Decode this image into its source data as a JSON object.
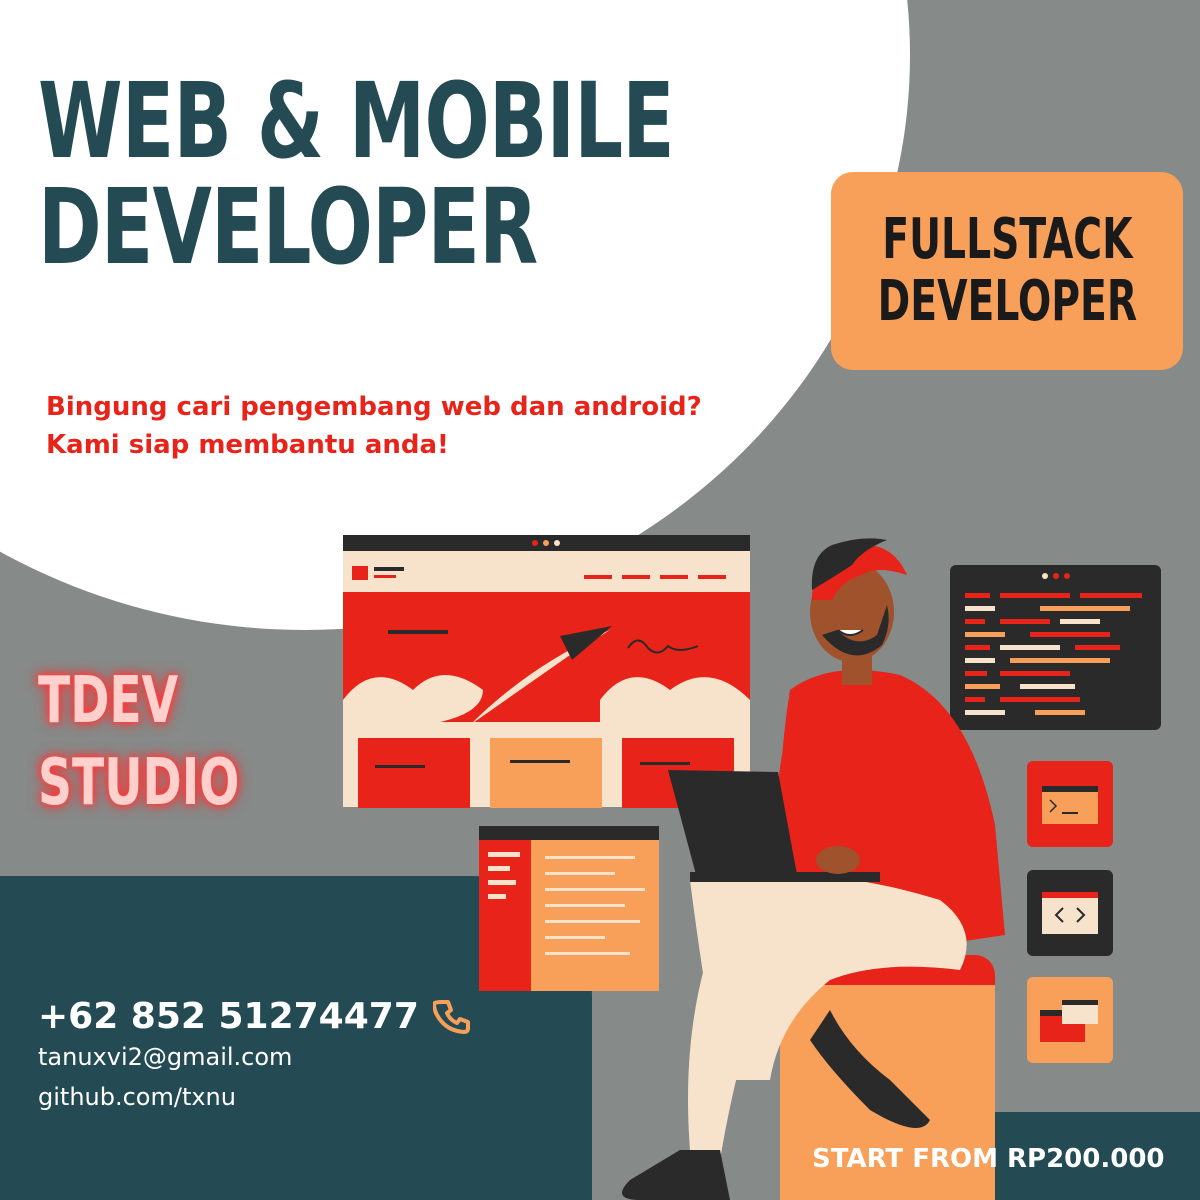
{
  "headline": {
    "line1": "WEB & MOBILE",
    "line2": "DEVELOPER"
  },
  "badge": {
    "line1": "FULLSTACK",
    "line2": "DEVELOPER"
  },
  "tagline": {
    "line1": "Bingung cari pengembang web dan android?",
    "line2": "Kami siap membantu anda!"
  },
  "studio": {
    "line1": "TDEV",
    "line2": "STUDIO"
  },
  "contact": {
    "phone": "+62 852 51274477",
    "email": "tanuxvi2@gmail.com",
    "github": "github.com/txnu"
  },
  "price": "START FROM RP200.000",
  "icons": [
    "phone-icon",
    "code-brackets-icon",
    "terminal-icon",
    "browser-window-icon"
  ],
  "colors": {
    "teal": "#244b54",
    "red": "#e8231a",
    "orange": "#f8a059",
    "grey": "#868a89",
    "cream": "#f7e3cc",
    "dark": "#2a2a2a"
  }
}
